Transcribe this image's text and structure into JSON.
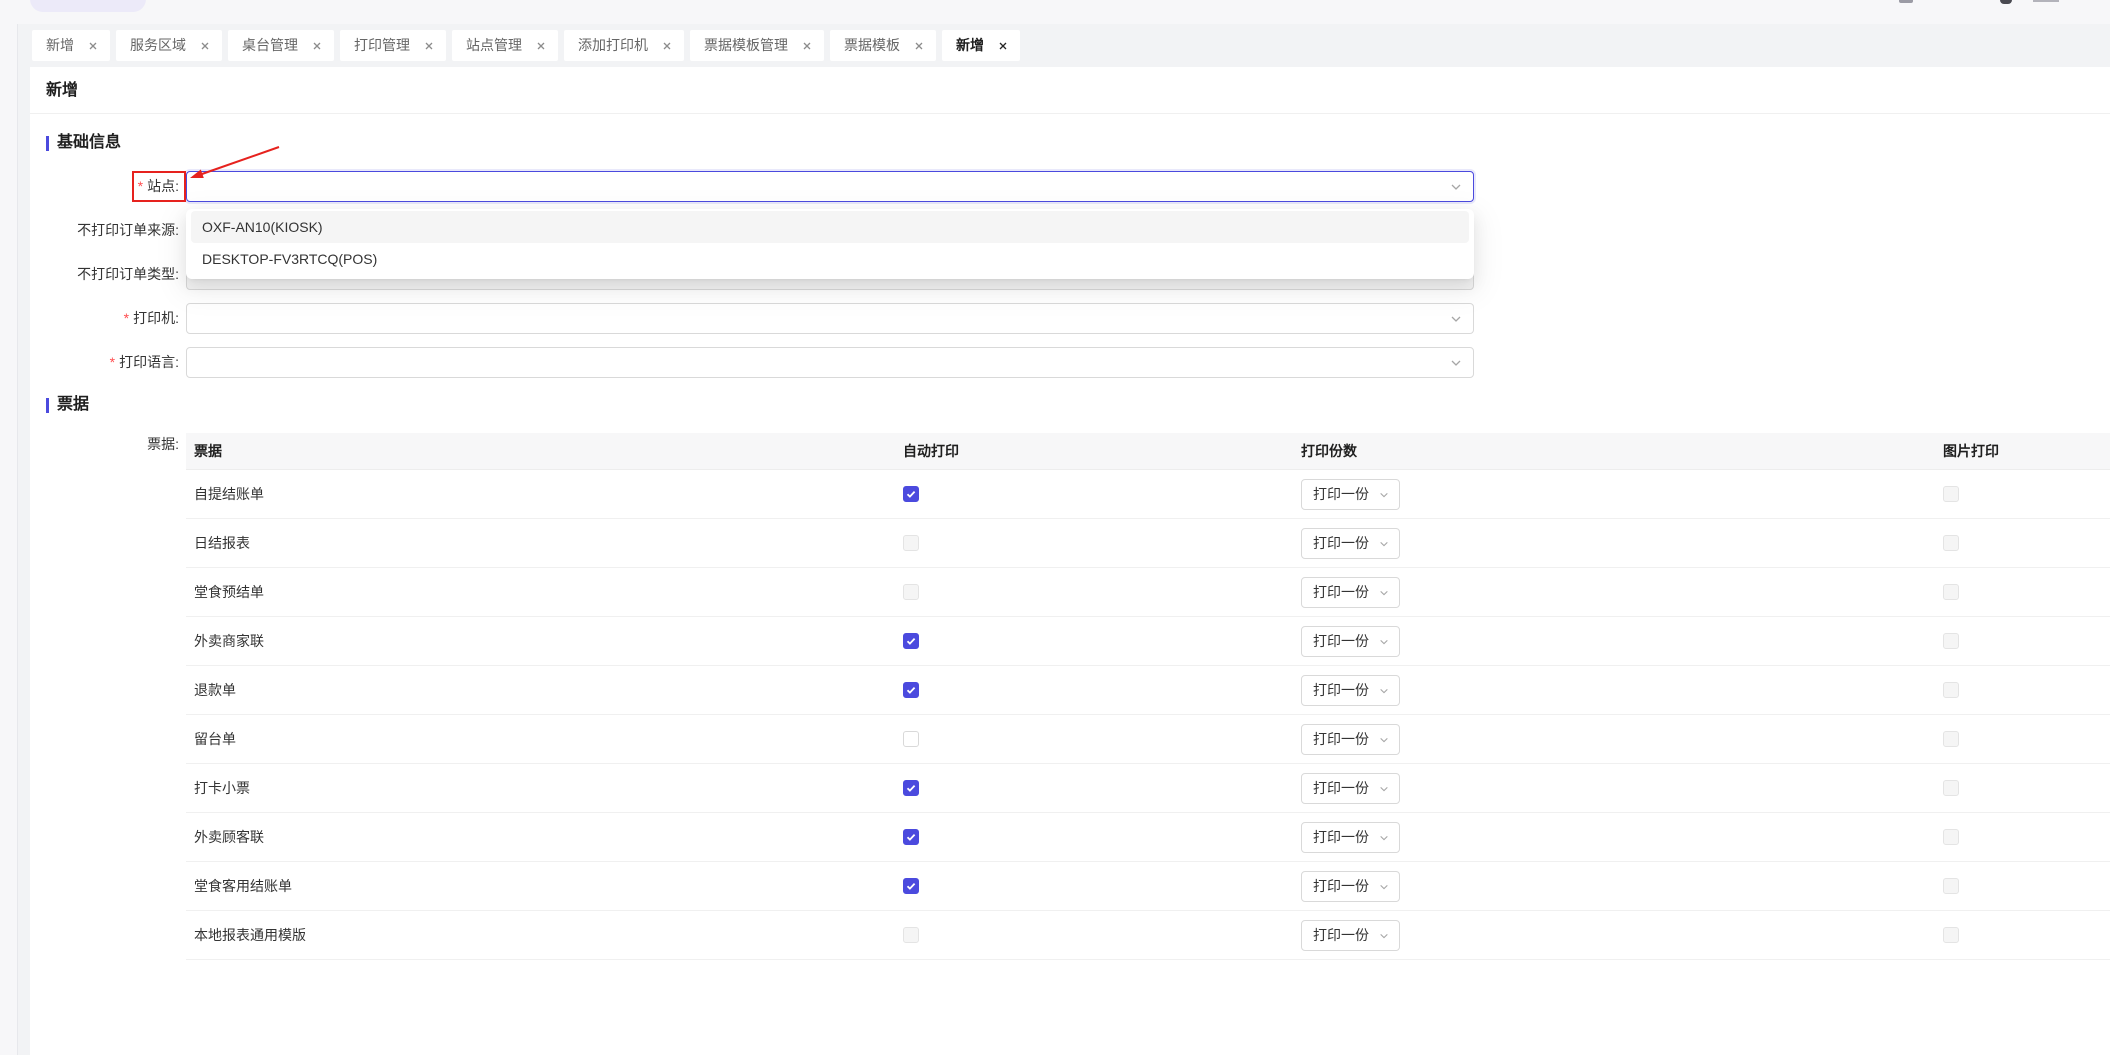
{
  "tabs": [
    {
      "label": "新增",
      "active": false
    },
    {
      "label": "服务区域",
      "active": false
    },
    {
      "label": "桌台管理",
      "active": false
    },
    {
      "label": "打印管理",
      "active": false
    },
    {
      "label": "站点管理",
      "active": false
    },
    {
      "label": "添加打印机",
      "active": false
    },
    {
      "label": "票据模板管理",
      "active": false
    },
    {
      "label": "票据模板",
      "active": false
    },
    {
      "label": "新增",
      "active": true
    }
  ],
  "page": {
    "title": "新增"
  },
  "basic_section": {
    "title": "基础信息"
  },
  "form": {
    "required_mark": "*",
    "site": {
      "label": "站点:",
      "value": "",
      "focused": true
    },
    "exclude_order_source": {
      "label": "不打印订单来源:",
      "value": ""
    },
    "exclude_order_type": {
      "label": "不打印订单类型:",
      "value": "",
      "disabled": true
    },
    "printer": {
      "label": "打印机:",
      "value": ""
    },
    "print_language": {
      "label": "打印语言:",
      "value": ""
    }
  },
  "site_dropdown": {
    "open": true,
    "options": [
      {
        "label": "OXF-AN10(KIOSK)",
        "highlighted": true
      },
      {
        "label": "DESKTOP-FV3RTCQ(POS)",
        "highlighted": false
      }
    ]
  },
  "ticket_section": {
    "title": "票据"
  },
  "ticket_table": {
    "label": "票据:",
    "columns": [
      "票据",
      "自动打印",
      "打印份数",
      "图片打印"
    ],
    "rows": [
      {
        "name": "自提结账单",
        "auto_print": true,
        "auto_print_disabled": false,
        "copies": "打印一份",
        "image_print": false,
        "image_print_disabled": true
      },
      {
        "name": "日结报表",
        "auto_print": false,
        "auto_print_disabled": true,
        "copies": "打印一份",
        "image_print": false,
        "image_print_disabled": true
      },
      {
        "name": "堂食预结单",
        "auto_print": false,
        "auto_print_disabled": true,
        "copies": "打印一份",
        "image_print": false,
        "image_print_disabled": true
      },
      {
        "name": "外卖商家联",
        "auto_print": true,
        "auto_print_disabled": false,
        "copies": "打印一份",
        "image_print": false,
        "image_print_disabled": true
      },
      {
        "name": "退款单",
        "auto_print": true,
        "auto_print_disabled": false,
        "copies": "打印一份",
        "image_print": false,
        "image_print_disabled": true
      },
      {
        "name": "留台单",
        "auto_print": false,
        "auto_print_disabled": false,
        "copies": "打印一份",
        "image_print": false,
        "image_print_disabled": true
      },
      {
        "name": "打卡小票",
        "auto_print": true,
        "auto_print_disabled": false,
        "copies": "打印一份",
        "image_print": false,
        "image_print_disabled": true
      },
      {
        "name": "外卖顾客联",
        "auto_print": true,
        "auto_print_disabled": false,
        "copies": "打印一份",
        "image_print": false,
        "image_print_disabled": true
      },
      {
        "name": "堂食客用结账单",
        "auto_print": true,
        "auto_print_disabled": false,
        "copies": "打印一份",
        "image_print": false,
        "image_print_disabled": true
      },
      {
        "name": "本地报表通用模版",
        "auto_print": false,
        "auto_print_disabled": true,
        "copies": "打印一份",
        "image_print": false,
        "image_print_disabled": true
      }
    ]
  },
  "colors": {
    "accent": "#4b4ade",
    "required": "#ff4d4f",
    "annotation": "#e6221e"
  },
  "icons": {
    "tab_close": "close-icon",
    "select_arrow": "chevron-down-icon",
    "checkbox_mark": "check-icon"
  }
}
